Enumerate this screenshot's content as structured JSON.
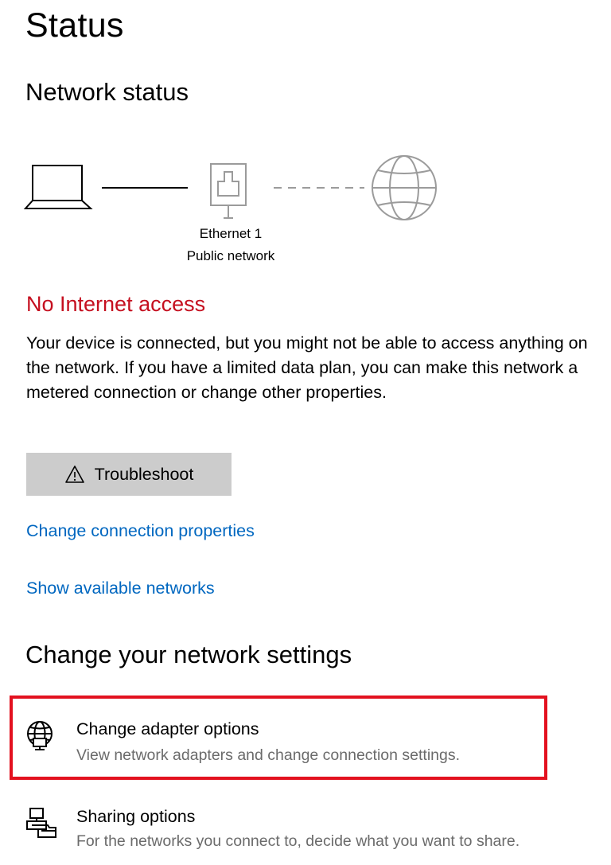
{
  "page": {
    "title": "Status"
  },
  "network_status": {
    "heading": "Network status",
    "adapter_name": "Ethernet 1",
    "network_type": "Public network",
    "status_title": "No Internet access",
    "status_description": "Your device is connected, but you might not be able to access anything on the network. If you have a limited data plan, you can make this network a metered connection or change other properties.",
    "troubleshoot_label": "Troubleshoot",
    "change_connection_properties": "Change connection properties",
    "show_available_networks": "Show available networks"
  },
  "change_settings": {
    "heading": "Change your network settings",
    "options": [
      {
        "icon": "adapter-globe-icon",
        "title": "Change adapter options",
        "subtitle": "View network adapters and change connection settings."
      },
      {
        "icon": "sharing-icon",
        "title": "Sharing options",
        "subtitle": "For the networks you connect to, decide what you want to share."
      }
    ]
  },
  "colors": {
    "error": "#c50f1f",
    "link": "#0067c0",
    "button_bg": "#cccccc",
    "highlight": "#e3111f"
  }
}
